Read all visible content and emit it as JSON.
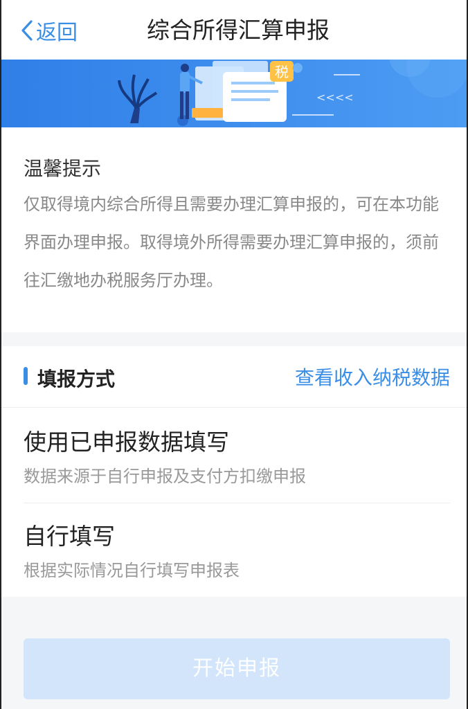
{
  "navbar": {
    "back_label": "返回",
    "title": "综合所得汇算申报"
  },
  "banner": {
    "badge_text": "税",
    "arrows_text": "<<<<"
  },
  "tips": {
    "title": "温馨提示",
    "text": "仅取得境内综合所得且需要办理汇算申报的，可在本功能界面办理申报。取得境外所得需要办理汇算申报的，须前往汇缴地办税服务厅办理。"
  },
  "method": {
    "title": "填报方式",
    "link": "查看收入纳税数据",
    "options": [
      {
        "title": "使用已申报数据填写",
        "desc": "数据来源于自行申报及支付方扣缴申报"
      },
      {
        "title": "自行填写",
        "desc": "根据实际情况自行填写申报表"
      }
    ]
  },
  "start_button": "开始申报",
  "colors": {
    "accent": "#3a8ee6",
    "banner": "#3d8ff0",
    "button_disabled": "#d2e5fb"
  }
}
